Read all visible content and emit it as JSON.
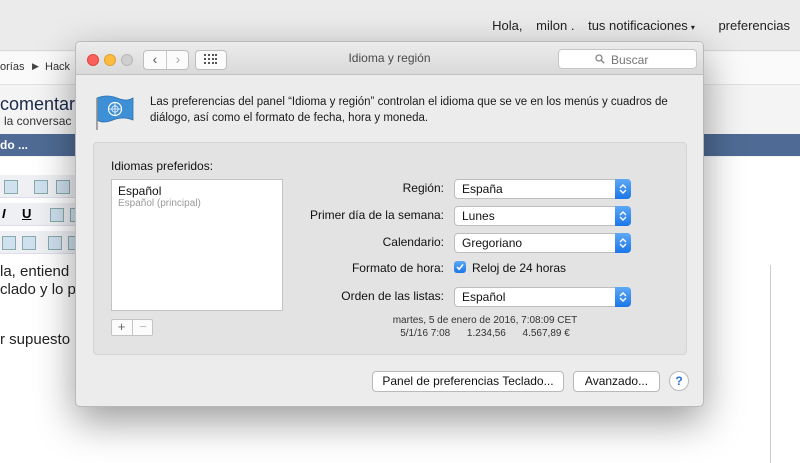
{
  "background": {
    "nav": {
      "greeting": "Hola,",
      "user": "milon .",
      "notifications": "tus notificaciones",
      "preferences": "preferencias"
    },
    "breadcrumb": {
      "item1": "orías",
      "item2": "Hack"
    },
    "title": "comentar",
    "subtitle": "la conversac",
    "bar_text": "do ...",
    "text_lines": [
      "la, entiend",
      "clado y lo p",
      "r supuesto"
    ]
  },
  "dialog": {
    "title": "Idioma y región",
    "search_placeholder": "Buscar",
    "description": "Las preferencias del panel “Idioma y región” controlan el idioma que se ve en los menús y cuadros de diálogo, así como el formato de fecha, hora y moneda.",
    "preferred_label": "Idiomas preferidos:",
    "languages": [
      {
        "name": "Español",
        "detail": "Español (principal)"
      }
    ],
    "add_symbol": "+",
    "remove_symbol": "−",
    "fields": {
      "region": {
        "label": "Región:",
        "value": "España"
      },
      "first_day": {
        "label": "Primer día de la semana:",
        "value": "Lunes"
      },
      "calendar": {
        "label": "Calendario:",
        "value": "Gregoriano"
      },
      "time_format": {
        "label": "Formato de hora:",
        "checkbox_label": "Reloj de 24 horas",
        "checked": true
      },
      "list_order": {
        "label": "Orden de las listas:",
        "value": "Español"
      }
    },
    "sample_date": "martes, 5 de enero de 2016, 7:08:09 CET",
    "sample_numbers": "5/1/16 7:08      1.234,56      4.567,89 €",
    "buttons": {
      "keyboard": "Panel de preferencias Teclado...",
      "advanced": "Avanzado...",
      "help": "?"
    }
  },
  "colors": {
    "accent": "#1b76e8",
    "close": "#fc605c",
    "minimize": "#fdbc40",
    "bar": "#4f6b95"
  },
  "icons": [
    "back-chevron-icon",
    "forward-chevron-icon",
    "grid-icon",
    "search-icon",
    "un-flag-icon",
    "select-arrows-icon",
    "checkmark-icon",
    "help-icon"
  ]
}
